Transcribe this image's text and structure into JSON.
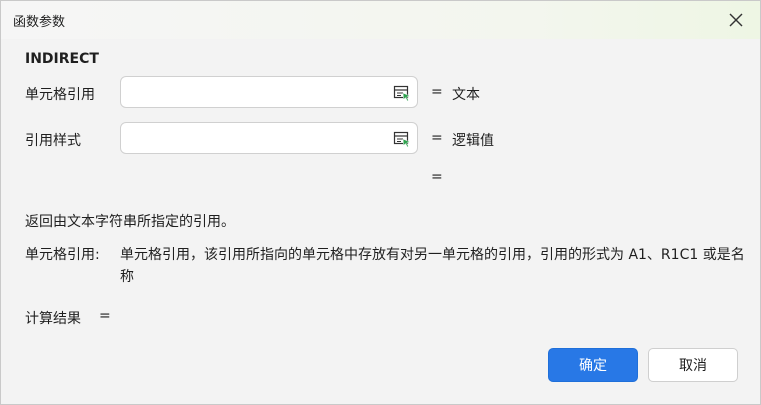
{
  "window": {
    "title": "函数参数",
    "close_icon": "close-icon"
  },
  "function": {
    "name": "INDIRECT"
  },
  "params": [
    {
      "label": "单元格引用",
      "value": "",
      "icon": "range-select-icon",
      "eq": "=",
      "result": "文本"
    },
    {
      "label": "引用样式",
      "value": "",
      "icon": "range-select-icon",
      "eq": "=",
      "result": "逻辑值"
    }
  ],
  "overall_eq": "=",
  "description": "返回由文本字符串所指定的引用。",
  "param_help": {
    "label": "单元格引用:",
    "text": "单元格引用，该引用所指向的单元格中存放有对另一单元格的引用，引用的形式为 A1、R1C1 或是名称"
  },
  "result": {
    "label": "计算结果",
    "eq": "="
  },
  "buttons": {
    "ok": "确定",
    "cancel": "取消"
  },
  "colors": {
    "primary": "#2878e6",
    "icon_green": "#2fa24f"
  }
}
